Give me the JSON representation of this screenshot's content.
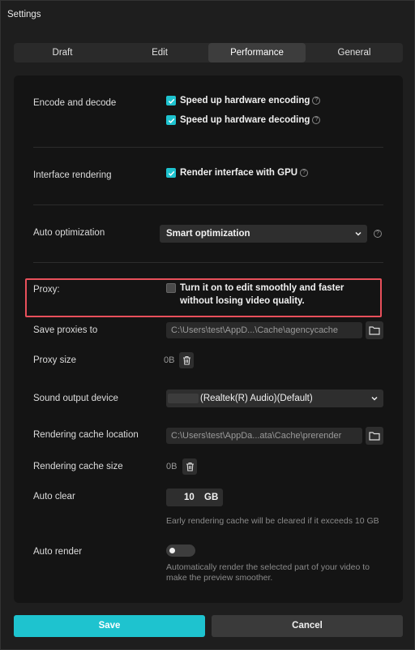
{
  "window": {
    "title": "Settings"
  },
  "tabs": [
    {
      "label": "Draft",
      "active": false
    },
    {
      "label": "Edit",
      "active": false
    },
    {
      "label": "Performance",
      "active": true
    },
    {
      "label": "General",
      "active": false
    }
  ],
  "encode": {
    "label": "Encode and decode",
    "hw_encoding": {
      "label": "Speed up hardware encoding",
      "checked": true
    },
    "hw_decoding": {
      "label": "Speed up hardware decoding",
      "checked": true
    }
  },
  "interface": {
    "label": "Interface rendering",
    "gpu": {
      "label": "Render interface with GPU",
      "checked": true
    }
  },
  "auto_optimization": {
    "label": "Auto optimization",
    "value": "Smart optimization"
  },
  "proxy": {
    "label": "Proxy:",
    "checkbox_label": "Turn it on to edit smoothly and faster without losing video quality.",
    "checked": false
  },
  "save_proxies": {
    "label": "Save proxies to",
    "path": "C:\\Users\\test\\AppD...\\Cache\\agencycache"
  },
  "proxy_size": {
    "label": "Proxy size",
    "value": "0B"
  },
  "sound_output": {
    "label": "Sound output device",
    "value": "(Realtek(R) Audio)(Default)"
  },
  "render_cache_location": {
    "label": "Rendering cache location",
    "path": "C:\\Users\\test\\AppDa...ata\\Cache\\prerender"
  },
  "render_cache_size": {
    "label": "Rendering cache size",
    "value": "0B"
  },
  "auto_clear": {
    "label": "Auto clear",
    "value": "10",
    "unit": "GB",
    "hint": "Early rendering cache will be cleared if it exceeds 10 GB"
  },
  "auto_render": {
    "label": "Auto render",
    "enabled": false,
    "hint": "Automatically render the selected part of your video to make the preview smoother."
  },
  "footer": {
    "save_label": "Save",
    "cancel_label": "Cancel"
  },
  "colors": {
    "accent": "#1ec3cf",
    "highlight": "#e8505b"
  }
}
